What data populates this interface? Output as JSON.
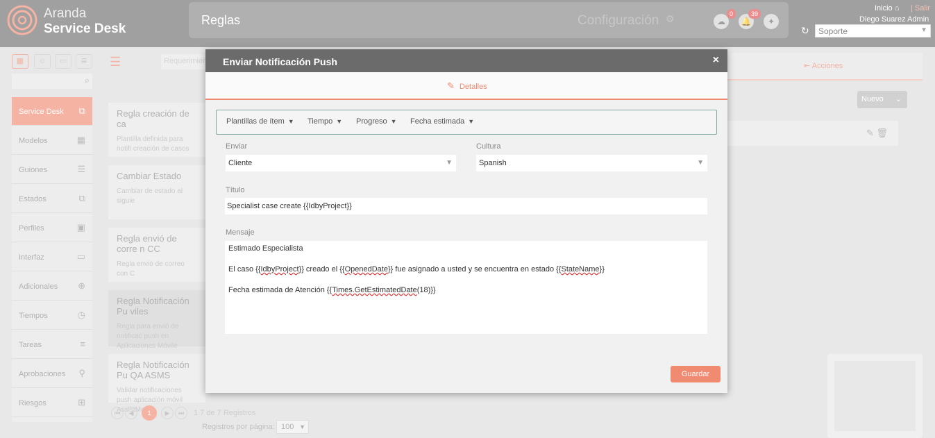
{
  "header": {
    "brand_line1": "Aranda",
    "brand_line2": "Service Desk",
    "page_title": "Reglas",
    "config_label": "Configuración",
    "cloud_badge": "0",
    "bell_badge": "39",
    "inicio_label": "Inicio",
    "salir_label": "| Salir",
    "user_name": "Diego Suarez Admin",
    "project_select": "Soporte"
  },
  "sidebar": {
    "items": [
      {
        "label": "Service Desk",
        "icon": "copy-icon"
      },
      {
        "label": "Modelos",
        "icon": "grid-icon"
      },
      {
        "label": "Guiones",
        "icon": "list-icon"
      },
      {
        "label": "Estados",
        "icon": "copy-icon"
      },
      {
        "label": "Perfiles",
        "icon": "badge-icon"
      },
      {
        "label": "Interfaz",
        "icon": "monitor-icon"
      },
      {
        "label": "Adicionales",
        "icon": "plus-circle-icon"
      },
      {
        "label": "Tiempos",
        "icon": "stopwatch-icon"
      },
      {
        "label": "Tareas",
        "icon": "tasks-icon"
      },
      {
        "label": "Aprobaciones",
        "icon": "stamp-icon"
      },
      {
        "label": "Riesgos",
        "icon": "barrier-icon"
      }
    ]
  },
  "list": {
    "filter_placeholder": "Requerimien",
    "cards": [
      {
        "title": "Regla creación de ca",
        "desc": "Plantilla definida para notifi creación de casos"
      },
      {
        "title": "Cambiar Estado",
        "desc": "Cambiar de estado al siguie"
      },
      {
        "title": "Regla envió de corre n CC",
        "desc": "Regla envió de correo con C"
      },
      {
        "title": "Regla Notificación Pu viles",
        "desc": "Regla para envió de notificac push en Aplicaciones Móvile"
      },
      {
        "title": "Regla Notificación Pu QA ASMS",
        "desc": "Validar notificaciones push aplicación móvil AssistMe"
      }
    ],
    "current_page": "1",
    "records_info": "1 7 de 7 Registros",
    "per_page_label": "Registros por página:",
    "per_page_value": "100"
  },
  "right": {
    "acciones_label": "Acciones",
    "nuevo_label": "Nuevo"
  },
  "modal": {
    "title": "Enviar Notificación Push",
    "close": "×",
    "tab_label": "Detalles",
    "toolbar": [
      "Plantillas de ítem",
      "Tiempo",
      "Progreso",
      "Fecha estimada"
    ],
    "enviar_label": "Enviar",
    "enviar_value": "Cliente",
    "cultura_label": "Cultura",
    "cultura_value": "Spanish",
    "titulo_label": "Título",
    "titulo_value": "Specialist case create {{IdbyProject}}",
    "mensaje_label": "Mensaje",
    "mensaje_line1": "Estimado Especialista",
    "mensaje_line2a": "El caso {{",
    "mensaje_var1": "IdbyProject",
    "mensaje_line2b": "}} creado el {{",
    "mensaje_var2": "OpenedDate",
    "mensaje_line2c": "}} fue asignado a usted y se encuentra en estado {{",
    "mensaje_var3": "StateName",
    "mensaje_line2d": "}}",
    "mensaje_line3a": "Fecha estimada de Atención {{",
    "mensaje_var4": "Times.GetEstimatedDate",
    "mensaje_line3b": "(18)}}",
    "save_label": "Guardar"
  }
}
